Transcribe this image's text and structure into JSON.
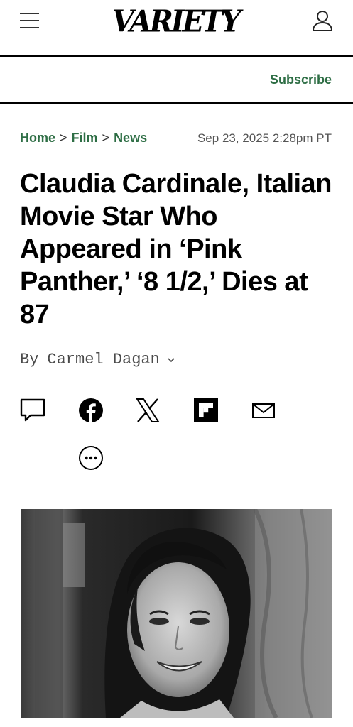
{
  "header": {
    "logo": "VARIETY",
    "menu_icon": "hamburger-menu-icon",
    "account_icon": "user-account-icon"
  },
  "subscribe_label": "Subscribe",
  "breadcrumb": {
    "items": [
      "Home",
      "Film",
      "News"
    ],
    "separator": ">"
  },
  "dateline": "Sep 23, 2025 2:28pm PT",
  "headline": "Claudia Cardinale, Italian Movie Star Who Appeared in ‘Pink Panther,’ ‘8 1/2,’ Dies at 87",
  "byline": {
    "prefix": "By",
    "author": "Carmel Dagan"
  },
  "share_icons": [
    "comment-icon",
    "facebook-icon",
    "x-icon",
    "flipboard-icon",
    "email-icon",
    "more-options-icon"
  ],
  "colors": {
    "accent_green": "#2e6e45",
    "text": "#000000",
    "muted": "#555555"
  }
}
